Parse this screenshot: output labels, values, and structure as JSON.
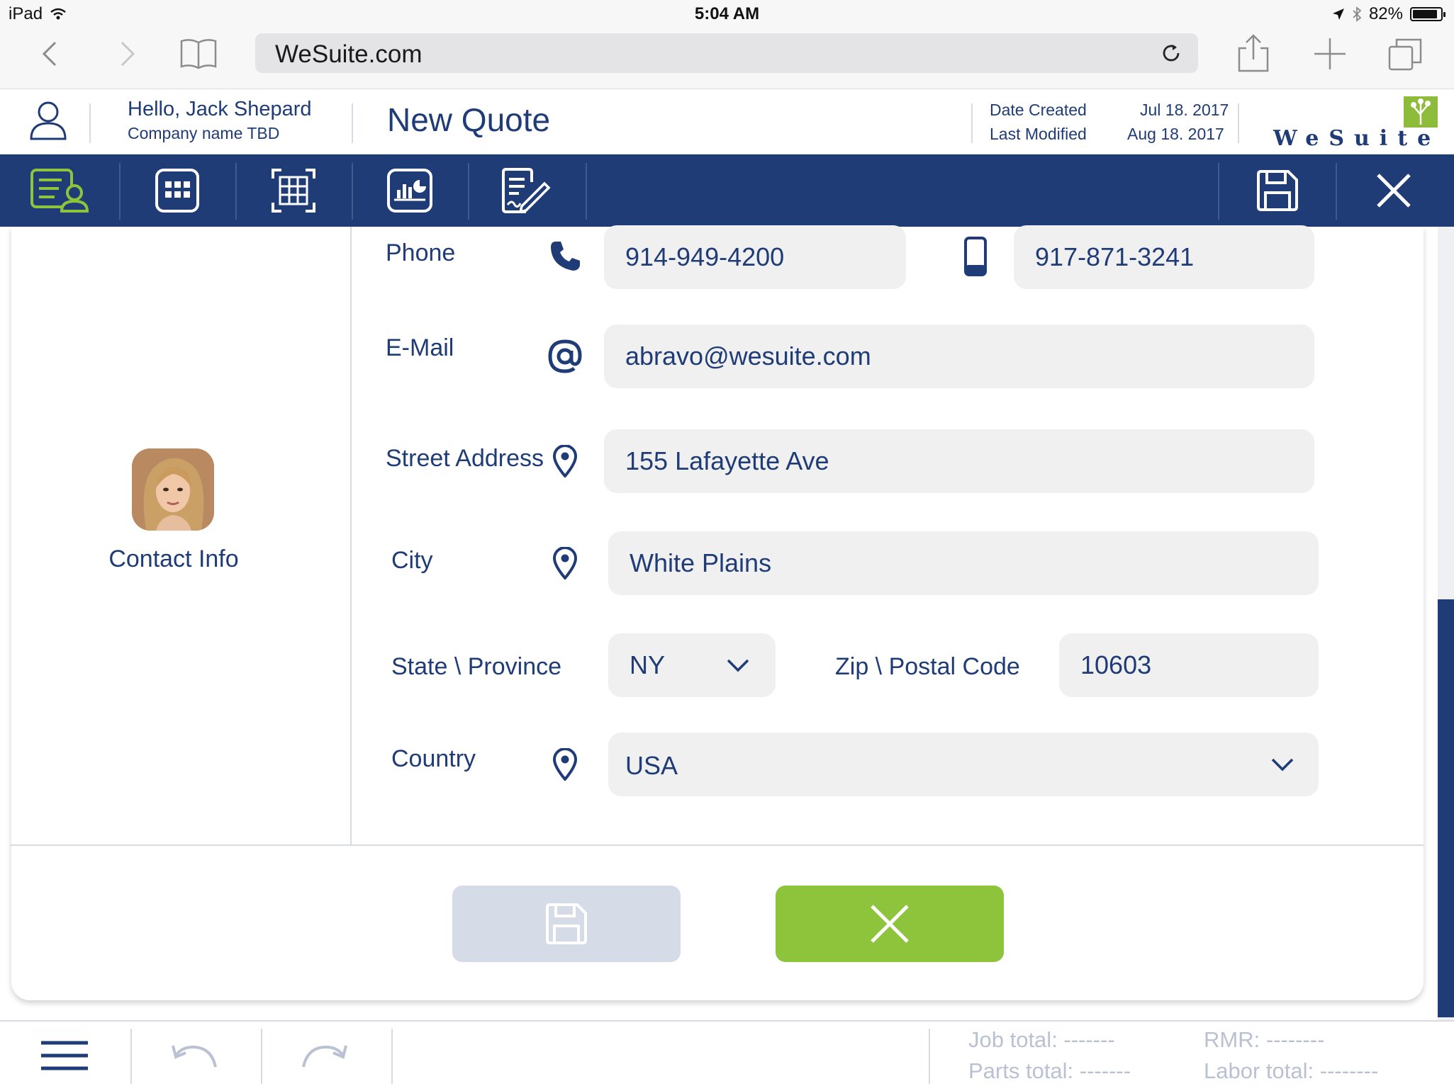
{
  "status_bar": {
    "device": "iPad",
    "time": "5:04 AM",
    "battery": "82%"
  },
  "browser": {
    "url": "WeSuite.com"
  },
  "header": {
    "greeting": "Hello, Jack Shepard",
    "company": "Company name TBD",
    "title": "New Quote",
    "date_created_label": "Date Created",
    "date_created_value": "Jul 18. 2017",
    "last_modified_label": "Last Modified",
    "last_modified_value": "Aug 18. 2017",
    "logo_text": "WeSuite"
  },
  "toolbar": {
    "items": [
      {
        "name": "contact-info-icon",
        "active": true
      },
      {
        "name": "grid-icon"
      },
      {
        "name": "table-icon"
      },
      {
        "name": "chart-report-icon"
      },
      {
        "name": "signature-doc-icon"
      },
      {
        "name": "save-icon"
      },
      {
        "name": "close-icon"
      }
    ],
    "active_color": "#8dc43c",
    "background": "#1f3c77"
  },
  "contact": {
    "section_label": "Contact Info"
  },
  "form": {
    "phone_label": "Phone",
    "phone_value": "914-949-4200",
    "mobile_value": "917-871-3241",
    "email_label": "E-Mail",
    "email_value": "abravo@wesuite.com",
    "street_label": "Street Address",
    "street_value": "155 Lafayette Ave",
    "city_label": "City",
    "city_value": "White Plains",
    "state_label": "State \\ Province",
    "state_value": "NY",
    "zip_label": "Zip \\ Postal Code",
    "zip_value": "10603",
    "country_label": "Country",
    "country_value": "USA"
  },
  "actions": {
    "save_color": "#d6dce7",
    "close_color": "#8dc43c"
  },
  "footer": {
    "job_total": "Job total: -------",
    "parts_total": "Parts total: -------",
    "rmr": "RMR: --------",
    "labor_total": "Labor total: --------"
  }
}
